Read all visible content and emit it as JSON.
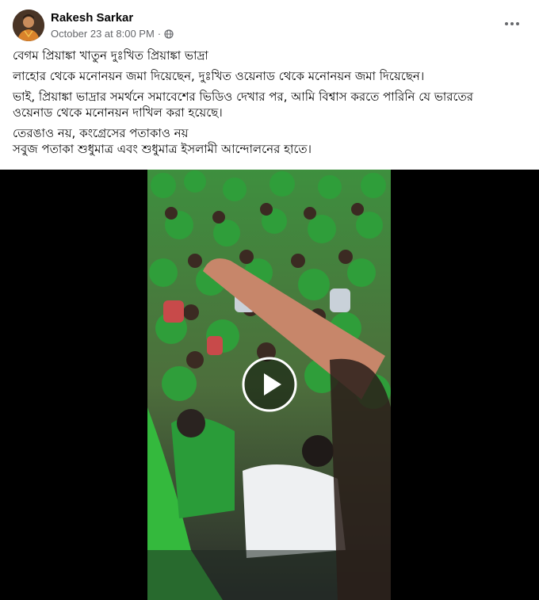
{
  "post": {
    "author": "Rakesh Sarkar",
    "timestamp": "October 23 at 8:00 PM",
    "separator": "·",
    "privacy_icon": "globe-icon",
    "more_icon": "more-horizontal-icon",
    "paragraphs": [
      {
        "lines": [
          "বেগম প্রিয়াঙ্কা খাতুন দুঃখিত প্রিয়াঙ্কা ভাদ্রা"
        ]
      },
      {
        "lines": [
          "লাহোর থেকে মনোনয়ন জমা দিয়েছেন, দুঃখিত ওয়েনাড থেকে মনোনয়ন জমা দিয়েছেন।"
        ]
      },
      {
        "lines": [
          "ভাই, প্রিয়াঙ্কা ভাদ্রার সমর্থনে সমাবেশের ভিডিও দেখার পর, আমি বিশ্বাস করতে পারিনি যে ভারতের",
          "ওয়েনাড থেকে মনোনয়ন দাখিল করা হয়েছে।"
        ]
      },
      {
        "lines": [
          "তেরঙাও নয়, কংগ্রেসের পতাকাও নয়",
          "সবুজ পতাকা শুধুমাত্র এবং শুধুমাত্র ইসলামী আন্দোলনের হাতে।"
        ]
      }
    ],
    "video": {
      "play_icon": "play-icon"
    }
  },
  "colors": {
    "text_primary": "#050505",
    "text_secondary": "#65676b",
    "video_background": "#000000",
    "crowd_green": "#2f9e3a"
  }
}
